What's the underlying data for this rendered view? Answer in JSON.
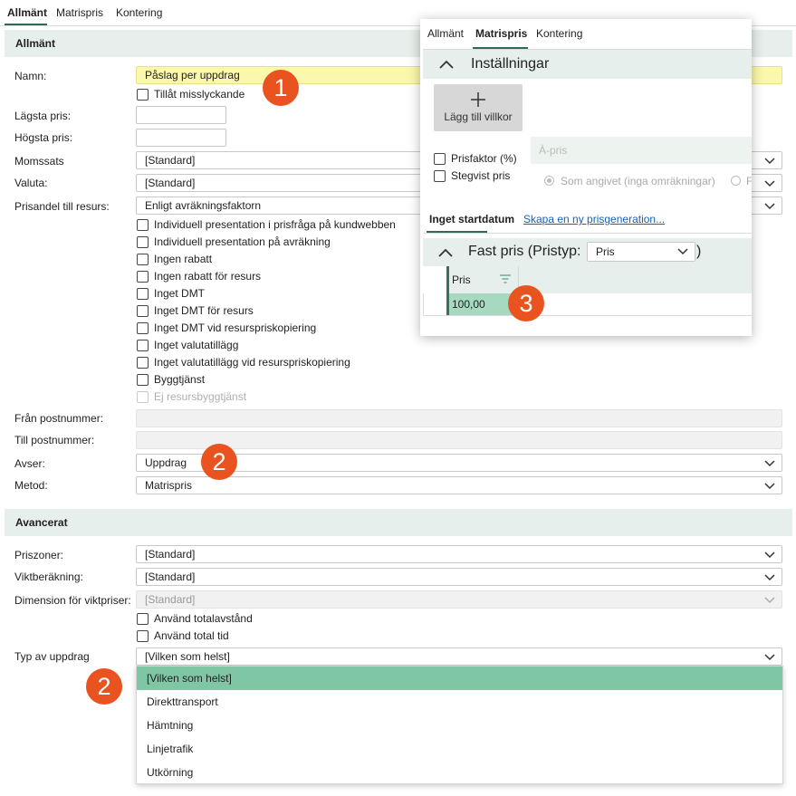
{
  "tabs": [
    "Allmänt",
    "Matrispris",
    "Kontering"
  ],
  "sections": {
    "allmant": "Allmänt",
    "avancerat": "Avancerat"
  },
  "fields": {
    "namn": {
      "label": "Namn:",
      "value": "Påslag per uppdrag"
    },
    "tillat_misslyckande": "Tillåt misslyckande",
    "lagsta_pris": {
      "label": "Lägsta pris:",
      "value": ""
    },
    "hogsta_pris": {
      "label": "Högsta pris:",
      "value": ""
    },
    "momssats": {
      "label": "Momssats",
      "value": "[Standard]"
    },
    "valuta": {
      "label": "Valuta:",
      "value": "[Standard]"
    },
    "prisandel": {
      "label": "Prisandel till resurs:",
      "value": "Enligt avräkningsfaktorn"
    },
    "fran_postnummer": {
      "label": "Från postnummer:",
      "value": ""
    },
    "till_postnummer": {
      "label": "Till postnummer:",
      "value": ""
    },
    "avser": {
      "label": "Avser:",
      "value": "Uppdrag"
    },
    "metod": {
      "label": "Metod:",
      "value": "Matrispris"
    }
  },
  "checkboxes": [
    "Individuell presentation i prisfråga på kundwebben",
    "Individuell presentation på avräkning",
    "Ingen rabatt",
    "Ingen rabatt för resurs",
    "Inget DMT",
    "Inget DMT för resurs",
    "Inget DMT vid resurspriskopiering",
    "Inget valutatillägg",
    "Inget valutatillägg vid resurspriskopiering",
    "Byggtjänst",
    "Ej resursbyggtjänst"
  ],
  "avancerat": {
    "priszoner": {
      "label": "Priszoner:",
      "value": "[Standard]"
    },
    "viktberakning": {
      "label": "Viktberäkning:",
      "value": "[Standard]"
    },
    "dimension": {
      "label": "Dimension för viktpriser:",
      "value": "[Standard]"
    },
    "anvand_totalavstand": "Använd totalavstånd",
    "anvand_total_tid": "Använd total tid",
    "typ_av_uppdrag": {
      "label": "Typ av uppdrag",
      "value": "[Vilken som helst]"
    }
  },
  "dropdown_options": [
    "[Vilken som helst]",
    "Direkttransport",
    "Hämtning",
    "Linjetrafik",
    "Utkörning"
  ],
  "badges": [
    "1",
    "2",
    "2",
    "3"
  ],
  "popup": {
    "tabs": [
      "Allmänt",
      "Matrispris",
      "Kontering"
    ],
    "installningar": "Inställningar",
    "add_condition": "Lägg till villkor",
    "prisfaktor": "Prisfaktor (%)",
    "stegvist_pris": "Stegvist pris",
    "apris_placeholder": "À-pris",
    "som_angivet": "Som angivet (inga omräkningar)",
    "radio2_partial": "F",
    "subtab_active": "Inget startdatum",
    "subtab_link": "Skapa en ny prisgeneration...",
    "fast_pris_title": "Fast pris (Pristyp:",
    "pristyp_value": "Pris",
    "close_paren": ")",
    "grid": {
      "column": "Pris",
      "value": "100,00"
    }
  },
  "colors": {
    "accent": "#2e6b52",
    "section_bg": "#e6efeb",
    "badge": "#e9531f",
    "selected": "#7fc7a4",
    "highlight_field": "#fbf7ad"
  }
}
